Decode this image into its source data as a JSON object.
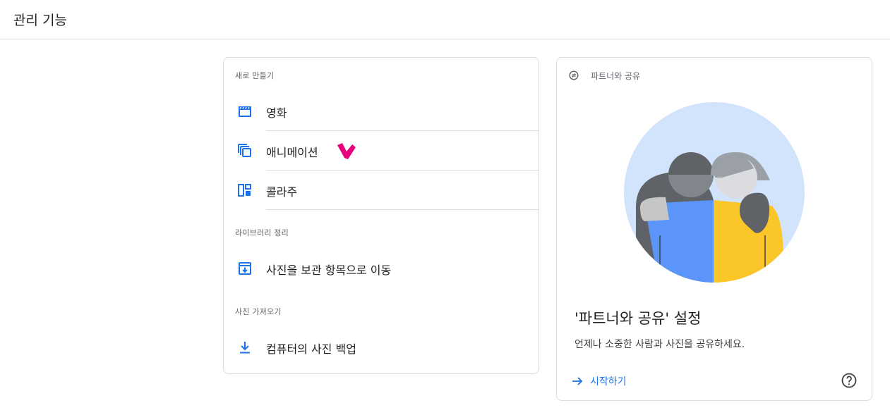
{
  "header": {
    "title": "관리 기능"
  },
  "left_card": {
    "sections": [
      {
        "title": "새로 만들기",
        "items": [
          {
            "label": "영화",
            "icon": "movie-icon"
          },
          {
            "label": "애니메이션",
            "icon": "animation-icon"
          },
          {
            "label": "콜라주",
            "icon": "collage-icon"
          }
        ]
      },
      {
        "title": "라이브러리 정리",
        "items": [
          {
            "label": "사진을 보관 항목으로 이동",
            "icon": "archive-icon"
          }
        ]
      },
      {
        "title": "사진 가져오기",
        "items": [
          {
            "label": "컴퓨터의 사진 백업",
            "icon": "download-icon"
          }
        ]
      }
    ]
  },
  "partner_card": {
    "header_label": "파트너와 공유",
    "header_icon": "partner-sharing-icon",
    "title": "'파트너와 공유' 설정",
    "description": "언제나 소중한 사람과 사진을 공유하세요.",
    "start_label": "시작하기",
    "help_icon": "help-icon"
  },
  "colors": {
    "accent": "#1a73e8",
    "marker": "#e6007e",
    "illustration_bg": "#d2e3fc"
  }
}
